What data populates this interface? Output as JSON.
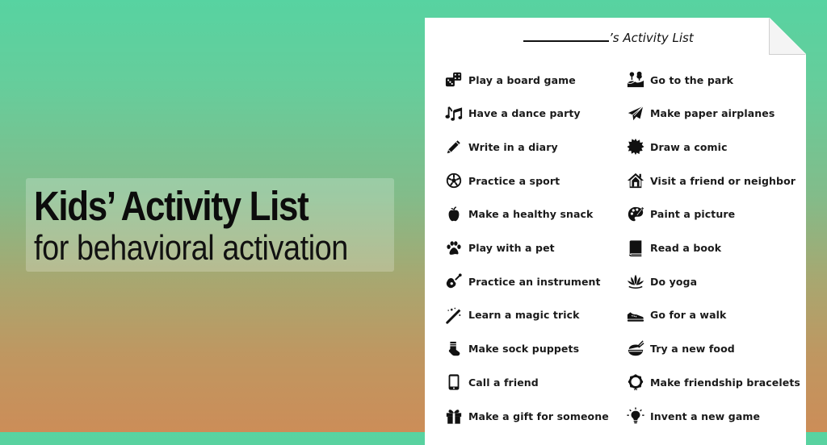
{
  "hero": {
    "title": "Kids’ Activity List",
    "subtitle": "for behavioral activation"
  },
  "sheet": {
    "title_suffix": "’s Activity List",
    "left_column": [
      {
        "icon": "dice-icon",
        "label": "Play a board game"
      },
      {
        "icon": "music-notes-icon",
        "label": "Have a dance party"
      },
      {
        "icon": "pencil-icon",
        "label": "Write in a diary"
      },
      {
        "icon": "soccer-ball-icon",
        "label": "Practice a sport"
      },
      {
        "icon": "apple-icon",
        "label": "Make a healthy snack"
      },
      {
        "icon": "paw-icon",
        "label": "Play with a pet"
      },
      {
        "icon": "guitar-icon",
        "label": "Practice an instrument"
      },
      {
        "icon": "magic-wand-icon",
        "label": "Learn a magic trick"
      },
      {
        "icon": "sock-icon",
        "label": "Make sock puppets"
      },
      {
        "icon": "phone-icon",
        "label": "Call a friend"
      },
      {
        "icon": "gift-icon",
        "label": "Make a gift for someone"
      }
    ],
    "right_column": [
      {
        "icon": "park-icon",
        "label": "Go to the park"
      },
      {
        "icon": "paper-plane-icon",
        "label": "Make paper airplanes"
      },
      {
        "icon": "comic-burst-icon",
        "label": "Draw a comic"
      },
      {
        "icon": "house-icon",
        "label": "Visit a friend or neighbor"
      },
      {
        "icon": "palette-icon",
        "label": "Paint a picture"
      },
      {
        "icon": "book-icon",
        "label": "Read a book"
      },
      {
        "icon": "lotus-icon",
        "label": "Do yoga"
      },
      {
        "icon": "sneaker-icon",
        "label": "Go for a walk"
      },
      {
        "icon": "rice-bowl-icon",
        "label": "Try a new food"
      },
      {
        "icon": "bracelet-icon",
        "label": "Make friendship bracelets"
      },
      {
        "icon": "lightbulb-icon",
        "label": "Invent a new game"
      }
    ]
  },
  "colors": {
    "gradient_top": "#57d3a1",
    "gradient_bottom": "#cc8d58",
    "paper": "#ffffff",
    "text": "#111111"
  }
}
